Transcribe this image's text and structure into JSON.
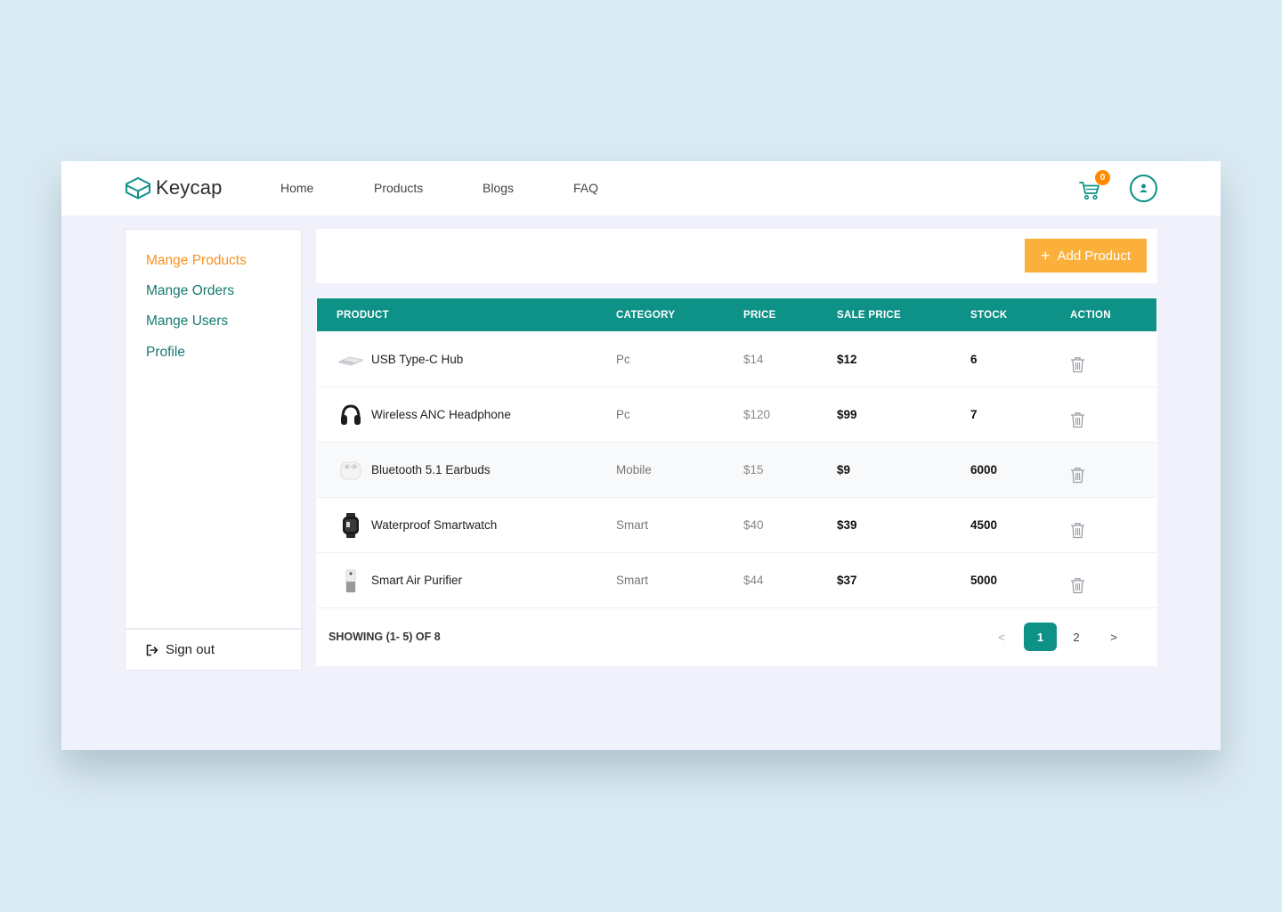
{
  "brand": {
    "name": "Keycap",
    "color": "#0e9186",
    "accent": "#f7931e",
    "button_color": "#fbb03b"
  },
  "nav": [
    {
      "label": "Home"
    },
    {
      "label": "Products"
    },
    {
      "label": "Blogs"
    },
    {
      "label": "FAQ"
    }
  ],
  "cart": {
    "count": "0",
    "icon": "cart-icon"
  },
  "user": {
    "icon": "user-icon"
  },
  "sidebar": {
    "items": [
      {
        "label": "Mange Products",
        "active": true
      },
      {
        "label": "Mange Orders",
        "active": false
      },
      {
        "label": "Mange Users",
        "active": false
      },
      {
        "label": "Profile",
        "active": false
      }
    ],
    "signout_label": "Sign out"
  },
  "actions": {
    "add_product_label": "Add Product",
    "add_icon": "+"
  },
  "table": {
    "columns": [
      "PRODUCT",
      "CATEGORY",
      "PRICE",
      "SALE PRICE",
      "STOCK",
      "ACTION"
    ],
    "rows": [
      {
        "name": "USB Type-C Hub",
        "category": "Pc",
        "price": "$14",
        "sale_price": "$12",
        "stock": "6",
        "thumb": "usb-hub-thumbnail"
      },
      {
        "name": "Wireless ANC Headphone",
        "category": "Pc",
        "price": "$120",
        "sale_price": "$99",
        "stock": "7",
        "thumb": "headphone-thumbnail"
      },
      {
        "name": "Bluetooth 5.1 Earbuds",
        "category": "Mobile",
        "price": "$15",
        "sale_price": "$9",
        "stock": "6000",
        "thumb": "earbuds-thumbnail"
      },
      {
        "name": "Waterproof Smartwatch",
        "category": "Smart",
        "price": "$40",
        "sale_price": "$39",
        "stock": "4500",
        "thumb": "smartwatch-thumbnail"
      },
      {
        "name": "Smart Air Purifier",
        "category": "Smart",
        "price": "$44",
        "sale_price": "$37",
        "stock": "5000",
        "thumb": "air-purifier-thumbnail"
      }
    ]
  },
  "pagination": {
    "summary": "SHOWING (1- 5) OF 8",
    "prev": "<",
    "pages": [
      "1",
      "2"
    ],
    "current": "1",
    "next": ">"
  }
}
